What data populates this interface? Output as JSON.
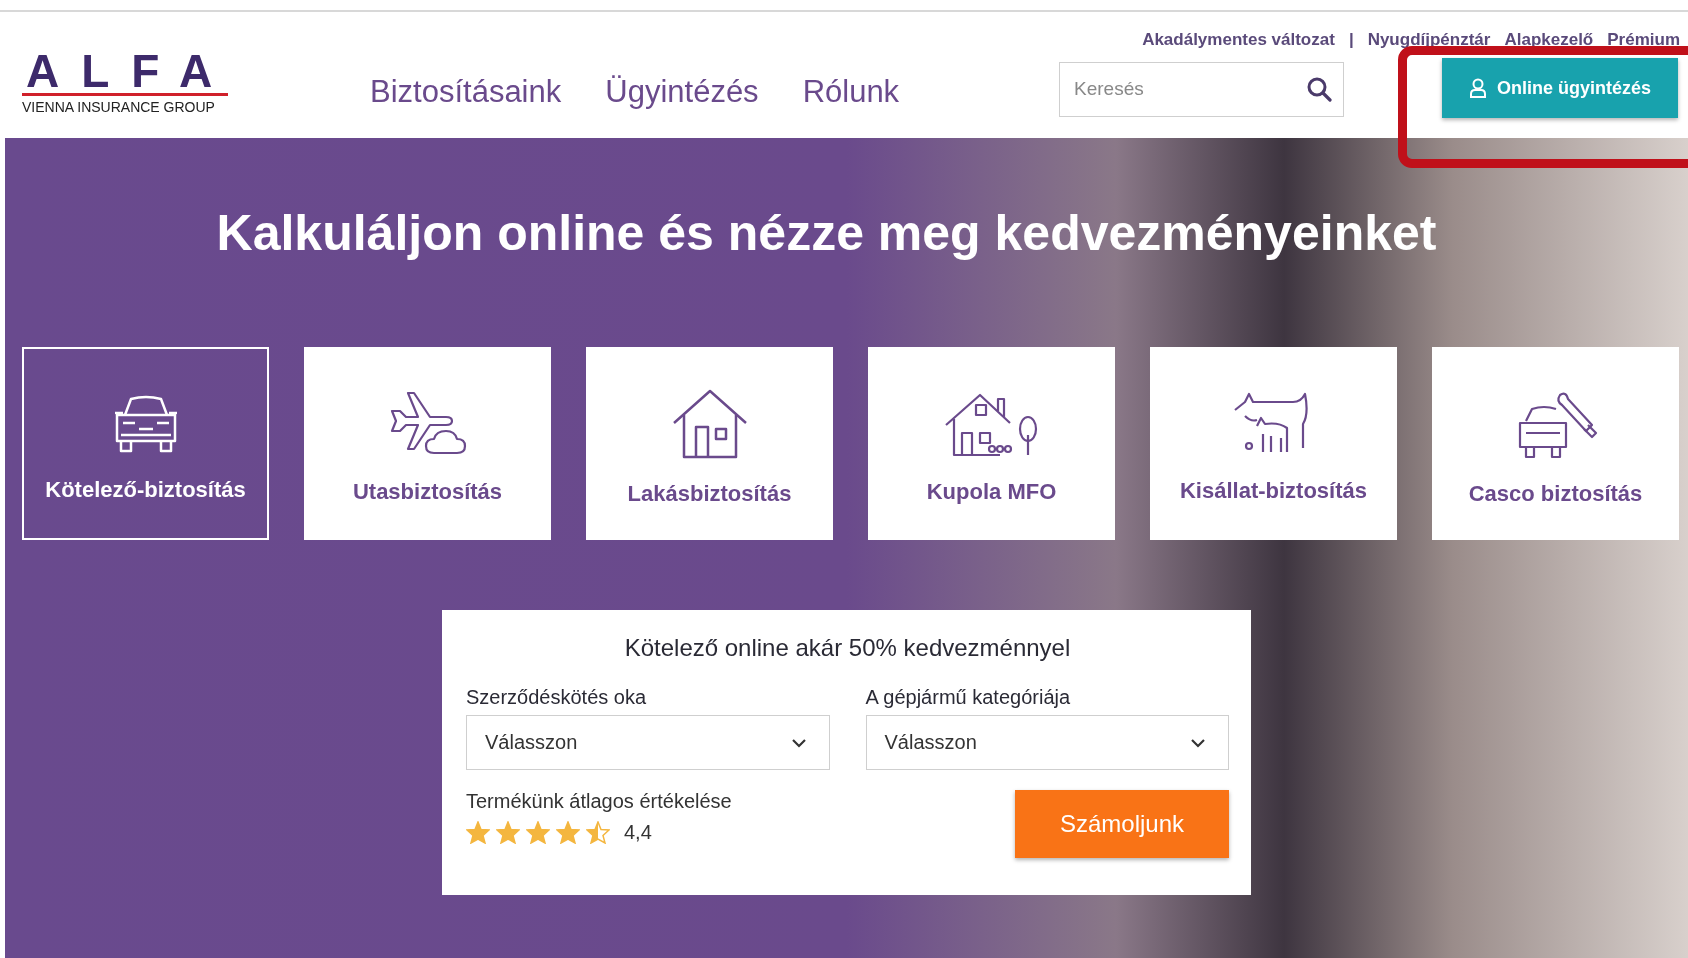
{
  "logo": {
    "mark": "ALFA",
    "subtitle": "VIENNA INSURANCE GROUP"
  },
  "nav": [
    "Biztosításaink",
    "Ügyintézés",
    "Rólunk"
  ],
  "top_links": {
    "items": [
      "Akadálymentes változat",
      "Nyugdíjpénztár",
      "Alapkezelő",
      "Prémium"
    ],
    "separator": "|"
  },
  "search": {
    "placeholder": "Keresés"
  },
  "online_button": {
    "label": "Online ügyintézés",
    "highlighted": true
  },
  "hero_title": "Kalkuláljon online és nézze meg kedvezményeinket",
  "products": [
    {
      "label": "Kötelező-biztosítás",
      "kind": "car",
      "selected": true
    },
    {
      "label": "Utasbiztosítás",
      "kind": "plane",
      "selected": false
    },
    {
      "label": "Lakásbiztosítás",
      "kind": "house",
      "selected": false
    },
    {
      "label": "Kupola MFO",
      "kind": "estate",
      "selected": false
    },
    {
      "label": "Kisállat-biztosítás",
      "kind": "pets",
      "selected": false
    },
    {
      "label": "Casco biztosítás",
      "kind": "repair",
      "selected": false
    }
  ],
  "calculator": {
    "title": "Kötelező online akár 50% kedvezménnyel",
    "fields": [
      {
        "label": "Szerződéskötés oka",
        "value": "Válasszon"
      },
      {
        "label": "A gépjármű kategóriája",
        "value": "Válasszon"
      }
    ],
    "rating_label": "Termékünk átlagos értékelése",
    "stars": 4.5,
    "rating": "4,4",
    "button": "Számoljunk"
  }
}
